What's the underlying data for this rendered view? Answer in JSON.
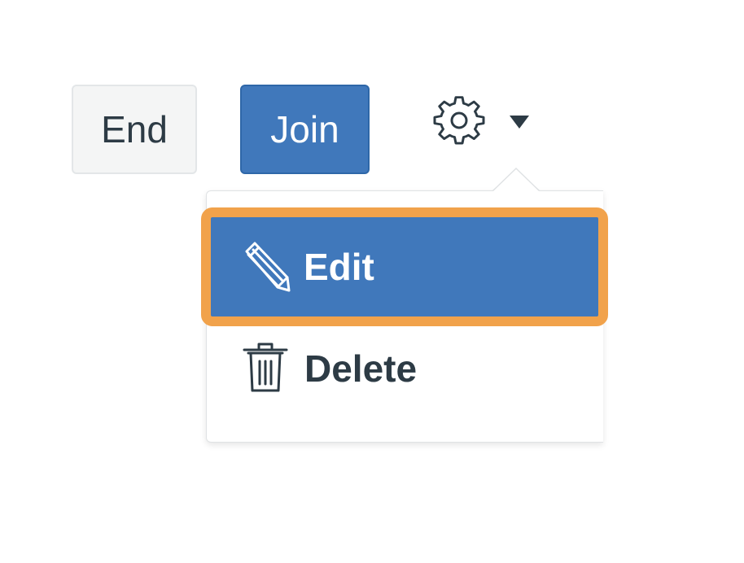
{
  "toolbar": {
    "end_label": "End",
    "join_label": "Join"
  },
  "settings": {
    "icon": "gear-icon",
    "caret": "caret-down-icon"
  },
  "menu": {
    "items": [
      {
        "label": "Edit",
        "icon": "pencil-icon",
        "highlighted": true
      },
      {
        "label": "Delete",
        "icon": "trash-icon",
        "highlighted": false
      }
    ]
  },
  "colors": {
    "primary": "#4078bb",
    "highlight_border": "#f1a24b",
    "text_dark": "#2d3b45",
    "button_light": "#f4f5f5"
  }
}
